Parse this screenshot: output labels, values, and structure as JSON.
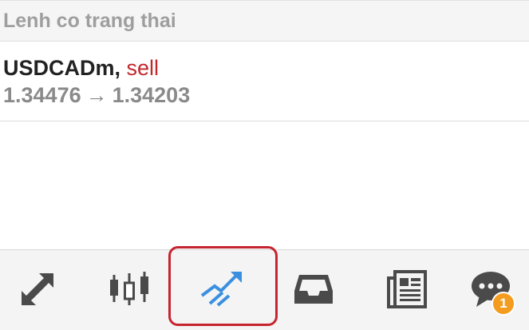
{
  "section": {
    "title": "Lenh co trang thai"
  },
  "order": {
    "symbol": "USDCADm,",
    "type": "sell",
    "open_price": "1.34476",
    "arrow": "→",
    "current_price": "1.34203"
  },
  "nav": {
    "items": [
      {
        "name": "quotes",
        "icon": "up-down-arrows-icon"
      },
      {
        "name": "chart",
        "icon": "candlestick-icon"
      },
      {
        "name": "trade",
        "icon": "trend-lines-icon",
        "active": true
      },
      {
        "name": "history",
        "icon": "inbox-tray-icon"
      },
      {
        "name": "news",
        "icon": "newspaper-icon"
      },
      {
        "name": "messages",
        "icon": "chat-bubble-icon",
        "badge": "1"
      }
    ]
  },
  "colors": {
    "sell": "#c0282b",
    "active_icon": "#3a8fe0",
    "icon": "#4a4a4a",
    "highlight": "#c62530",
    "badge": "#f39c1f"
  }
}
